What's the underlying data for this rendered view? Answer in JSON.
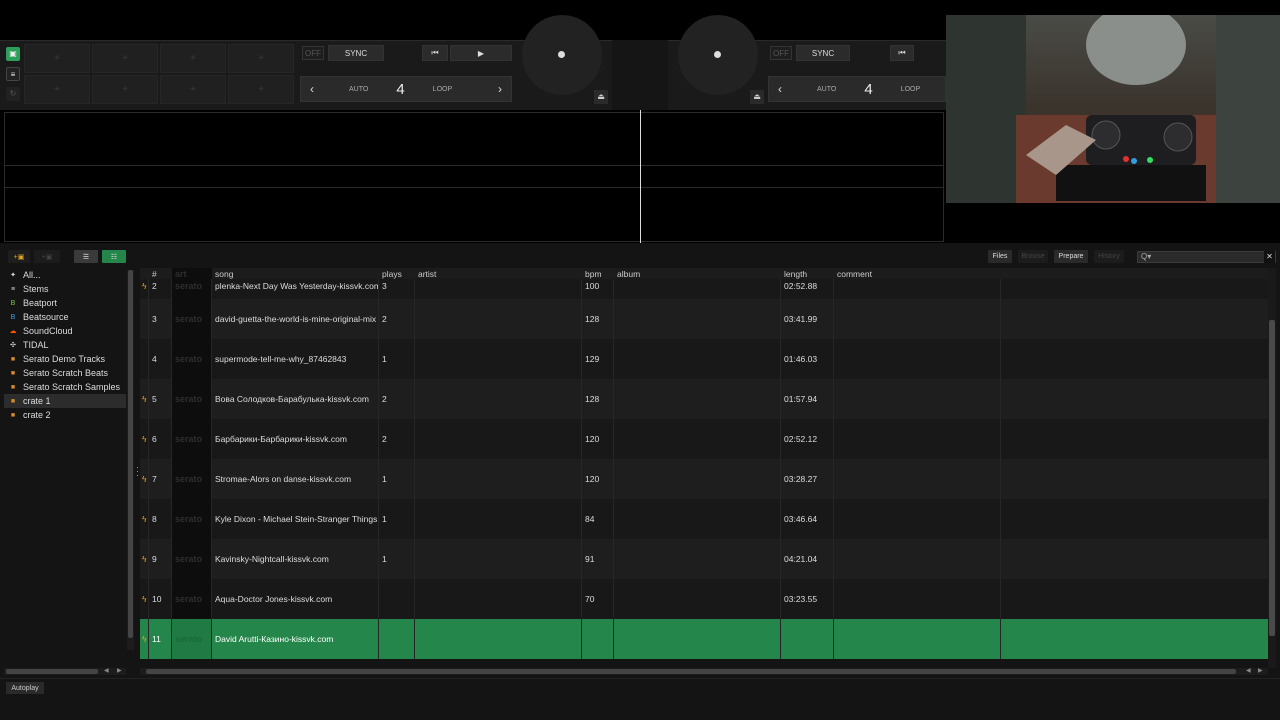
{
  "deck_left": {
    "off_label": "OFF",
    "sync_label": "SYNC",
    "loop_auto_label": "AUTO",
    "loop_size": "4",
    "loop_label": "LOOP"
  },
  "deck_right": {
    "off_label": "OFF",
    "sync_label": "SYNC",
    "loop_auto_label": "AUTO",
    "loop_size": "4",
    "loop_label": "LOOP"
  },
  "toolbar": {
    "files_label": "Files",
    "browse_label": "Browse",
    "prepare_label": "Prepare",
    "history_label": "History",
    "search_placeholder": "",
    "search_icon": "Q▾",
    "autoplay_label": "Autoplay"
  },
  "sidebar": {
    "items": [
      {
        "label": "All...",
        "icon": "all-icon",
        "color": "#ddd"
      },
      {
        "label": "Stems",
        "icon": "stems-icon",
        "color": "#ddd"
      },
      {
        "label": "Beatport",
        "icon": "beatport-icon",
        "color": "#7ac943"
      },
      {
        "label": "Beatsource",
        "icon": "beatsource-icon",
        "color": "#3ba4e8"
      },
      {
        "label": "SoundCloud",
        "icon": "soundcloud-icon",
        "color": "#ff5500"
      },
      {
        "label": "TIDAL",
        "icon": "tidal-icon",
        "color": "#ddd"
      },
      {
        "label": "Serato Demo Tracks",
        "icon": "crate-icon",
        "color": "#d98b2b"
      },
      {
        "label": "Serato Scratch Beats",
        "icon": "crate-icon",
        "color": "#d98b2b"
      },
      {
        "label": "Serato Scratch Samples",
        "icon": "crate-icon",
        "color": "#d98b2b"
      },
      {
        "label": "crate 1",
        "icon": "crate-icon",
        "color": "#d98b2b"
      },
      {
        "label": "crate 2",
        "icon": "crate-icon",
        "color": "#d98b2b"
      }
    ]
  },
  "table": {
    "columns": [
      "#",
      "art",
      "song",
      "plays",
      "artist",
      "bpm",
      "album",
      "length",
      "comment"
    ],
    "rows": [
      {
        "num": "2",
        "song": "plenka-Next Day Was Yesterday-kissvk.com",
        "plays": "3",
        "artist": "",
        "bpm": "100",
        "album": "",
        "length": "02:52.88",
        "comment": "",
        "flag": true
      },
      {
        "num": "3",
        "song": "david-guetta-the-world-is-mine-original-mix",
        "plays": "2",
        "artist": "",
        "bpm": "128",
        "album": "",
        "length": "03:41.99",
        "comment": "",
        "flag": false
      },
      {
        "num": "4",
        "song": "supermode-tell-me-why_87462843",
        "plays": "1",
        "artist": "",
        "bpm": "129",
        "album": "",
        "length": "01:46.03",
        "comment": "",
        "flag": false
      },
      {
        "num": "5",
        "song": "Вова Солодков-Барабулька-kissvk.com",
        "plays": "2",
        "artist": "",
        "bpm": "128",
        "album": "",
        "length": "01:57.94",
        "comment": "",
        "flag": true
      },
      {
        "num": "6",
        "song": "Барбарики-Барбарики-kissvk.com",
        "plays": "2",
        "artist": "",
        "bpm": "120",
        "album": "",
        "length": "02:52.12",
        "comment": "",
        "flag": true
      },
      {
        "num": "7",
        "song": "Stromae-Alors on danse-kissvk.com",
        "plays": "1",
        "artist": "",
        "bpm": "120",
        "album": "",
        "length": "03:28.27",
        "comment": "",
        "flag": true
      },
      {
        "num": "8",
        "song": "Kyle Dixon - Michael Stein-Stranger Things",
        "plays": "1",
        "artist": "",
        "bpm": "84",
        "album": "",
        "length": "03:46.64",
        "comment": "",
        "flag": true
      },
      {
        "num": "9",
        "song": "Kavinsky-Nightcall-kissvk.com",
        "plays": "1",
        "artist": "",
        "bpm": "91",
        "album": "",
        "length": "04:21.04",
        "comment": "",
        "flag": true
      },
      {
        "num": "10",
        "song": "Aqua-Doctor Jones-kissvk.com",
        "plays": "",
        "artist": "",
        "bpm": "70",
        "album": "",
        "length": "03:23.55",
        "comment": "",
        "flag": true
      },
      {
        "num": "11",
        "song": "David Arutti-Казино-kissvk.com",
        "plays": "",
        "artist": "",
        "bpm": "",
        "album": "",
        "length": "",
        "comment": "",
        "flag": true
      }
    ],
    "art_placeholder": "serato",
    "selected_index": 9
  },
  "colors": {
    "accent_green": "#25864b",
    "flag_orange": "#e6a823"
  }
}
